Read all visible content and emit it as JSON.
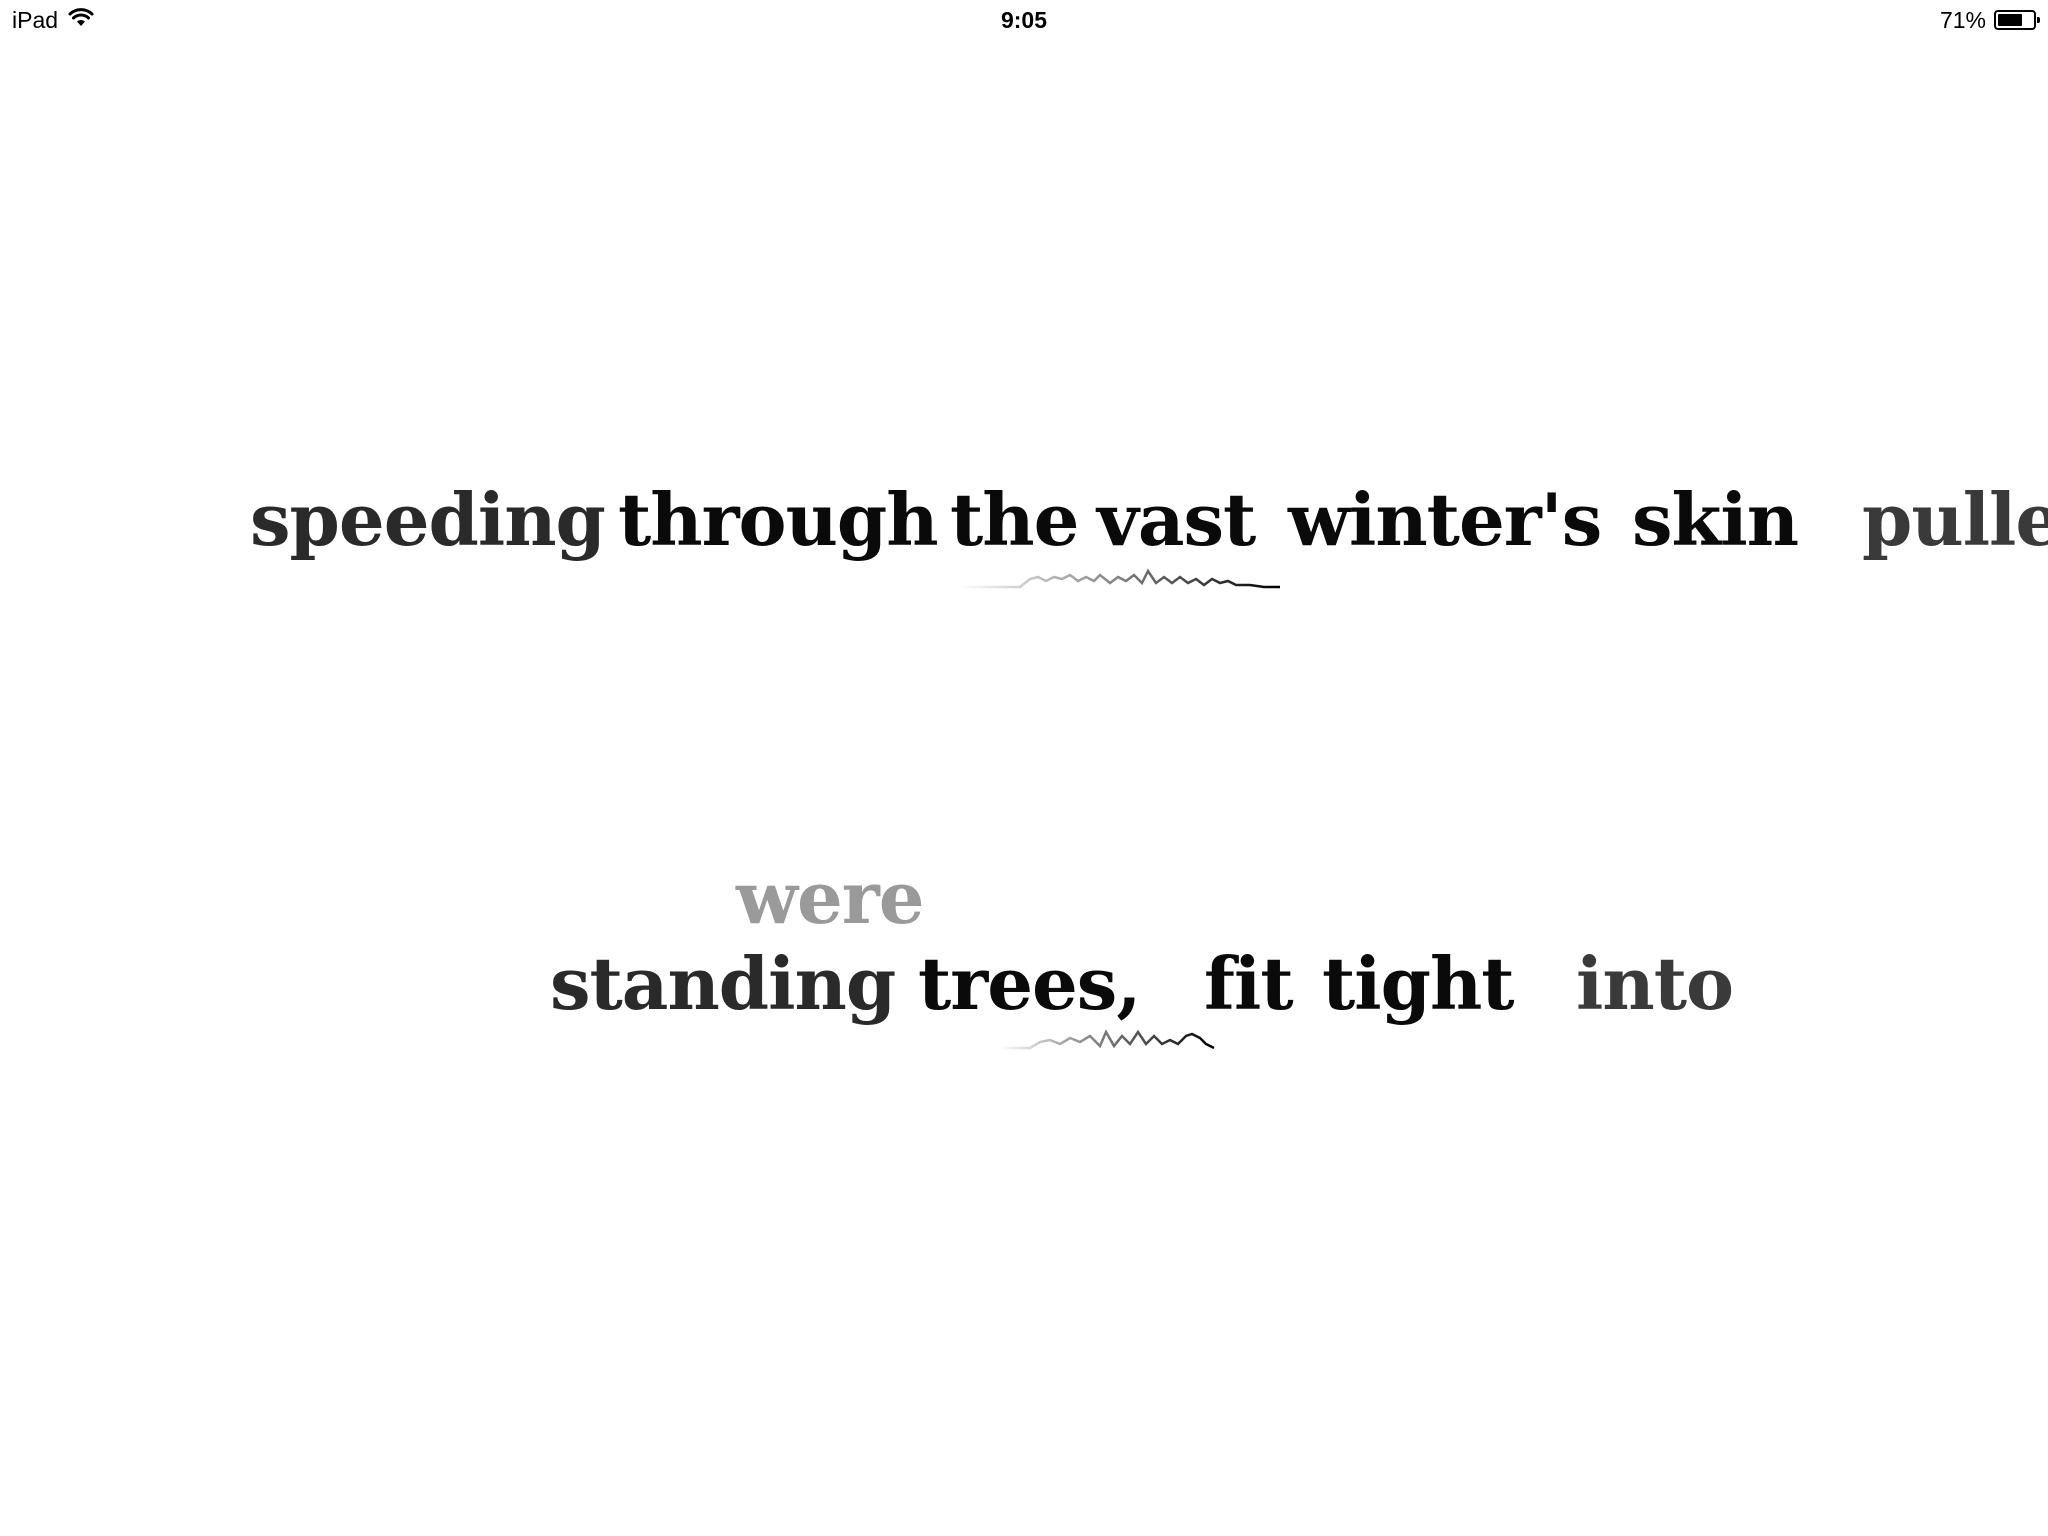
{
  "status_bar": {
    "device": "iPad",
    "time": "9:05",
    "battery_percent_label": "71%",
    "battery_level": 0.71,
    "wifi_icon": "wifi-icon",
    "battery_icon": "battery-icon"
  },
  "poem": {
    "line1": {
      "words": [
        {
          "text": "speeding",
          "color": "#2a2a2a"
        },
        {
          "text": "through",
          "color": "#0a0a0a"
        },
        {
          "text": "the",
          "color": "#0a0a0a"
        },
        {
          "text": "vast",
          "color": "#0a0a0a"
        },
        {
          "text": "winter's",
          "color": "#0a0a0a"
        },
        {
          "text": "skin",
          "color": "#0a0a0a"
        },
        {
          "text": "pulle",
          "color": "#3a3a3a"
        }
      ]
    },
    "floating_word": {
      "text": "were",
      "color": "#9a9a9a"
    },
    "line2": {
      "words": [
        {
          "text": "standing",
          "color": "#2a2a2a"
        },
        {
          "text": "trees,",
          "color": "#0a0a0a"
        },
        {
          "text": "fit",
          "color": "#0a0a0a"
        },
        {
          "text": "tight",
          "color": "#0a0a0a"
        },
        {
          "text": "into",
          "color": "#3a3a3a"
        }
      ]
    }
  }
}
